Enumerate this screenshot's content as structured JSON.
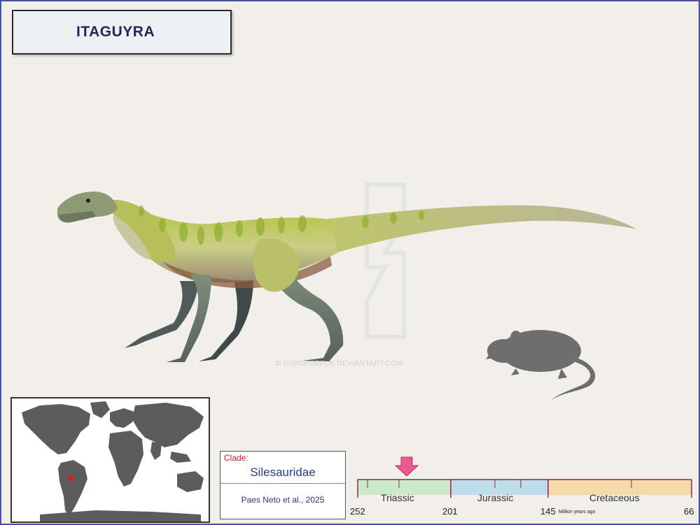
{
  "title": "ITAGUYRA",
  "watermark": "© CISIOPURPLE.DEVIANTART.COM",
  "clade": {
    "label": "Clade:",
    "name": "Silesauridae",
    "citation": "Paes Neto et al., 2025"
  },
  "timeline": {
    "periods": [
      {
        "name": "Triassic",
        "start": 252,
        "end": 201,
        "color": "#cdeac8"
      },
      {
        "name": "Jurassic",
        "start": 201,
        "end": 145,
        "color": "#bfdceb"
      },
      {
        "name": "Cretaceous",
        "start": 145,
        "end": 66,
        "color": "#f6d9a9"
      }
    ],
    "ticks": [
      "252",
      "201",
      "145",
      "66"
    ],
    "unit_label": "Million years ago",
    "marker_color": "#e85b8f"
  },
  "colors": {
    "frame": "#4b4f9c",
    "map_land": "#5c5c5c",
    "locality_dot": "#c0282e"
  },
  "icons": [
    "itaguyra-illustration",
    "rat-silhouette",
    "world-map",
    "locality-marker",
    "period-arrow"
  ]
}
